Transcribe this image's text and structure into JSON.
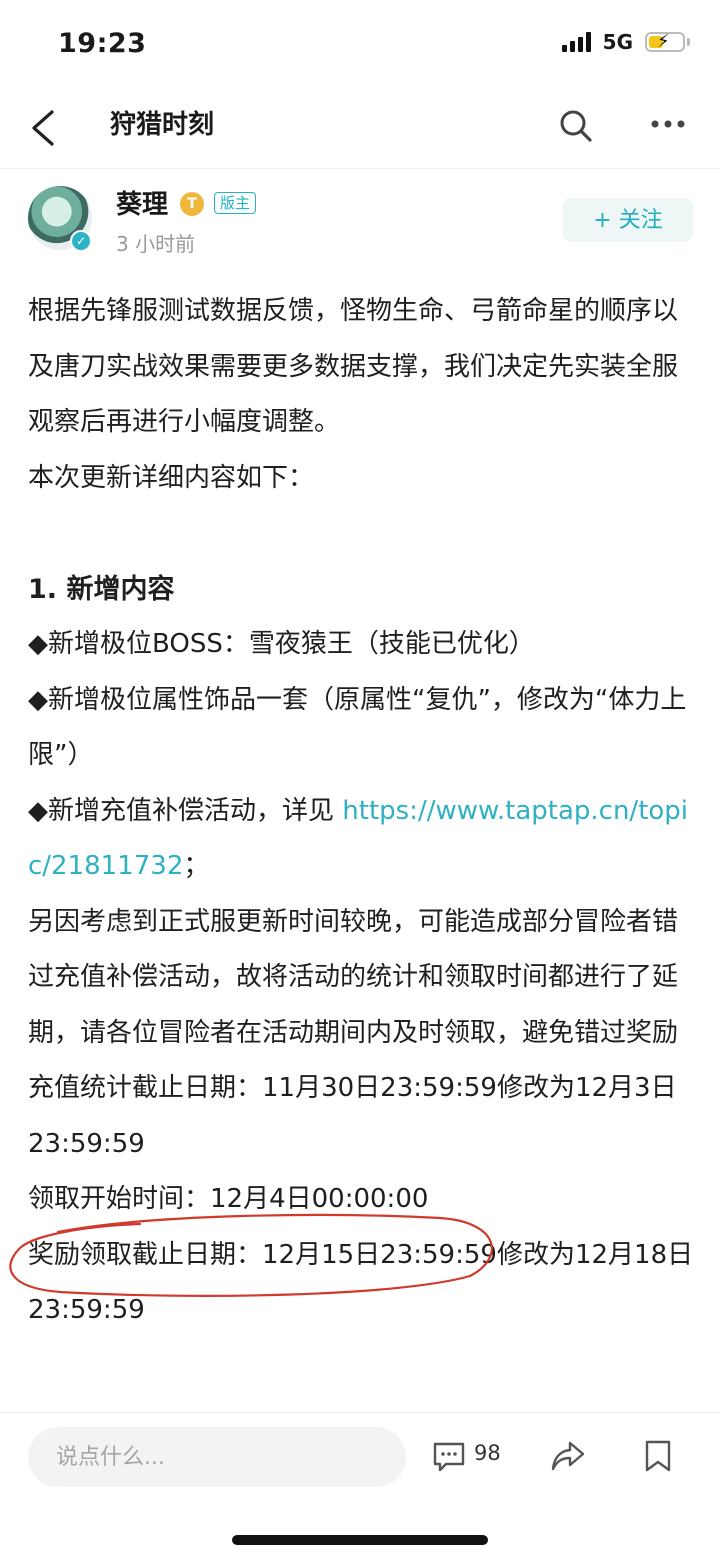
{
  "status_bar": {
    "time": "19:23",
    "network": "5G",
    "icons": [
      "signal-icon",
      "battery-charging-icon"
    ]
  },
  "nav": {
    "title": "狩猎时刻",
    "icons": [
      "back-icon",
      "search-icon",
      "more-icon"
    ]
  },
  "author": {
    "name": "葵理",
    "level_badge": "T",
    "role_badge": "版主",
    "time": "3 小时前",
    "follow_label": "+ 关注",
    "accent_color": "#22b3c5"
  },
  "content": {
    "intro_1": "根据先锋服测试数据反馈，怪物生命、弓箭命星的顺序以及唐刀实战效果需要更多数据支撑，我们决定先实装全服观察后再进行小幅度调整。",
    "intro_2": "本次更新详细内容如下：",
    "section_1": "1. 新增内容",
    "item_1": "◆新增极位BOSS：雪夜猿王（技能已优化）",
    "item_2": "◆新增极位属性饰品一套（原属性“复仇”，修改为“体力上限”）",
    "item_3_prefix": "◆新增充值补偿活动，详见 ",
    "item_3_link": "https://www.taptap.cn/topic/21811732",
    "item_3_suffix": "；",
    "note": "另因考虑到正式服更新时间较晚，可能造成部分冒险者错过充值补偿活动，故将活动的统计和领取时间都进行了延期，请各位冒险者在活动期间内及时领取，避免错过奖励",
    "date_1": "充值统计截止日期：11月30日23:59:59修改为12月3日23:59:59",
    "date_2": "领取开始时间：12月4日00:00:00",
    "date_3": "奖励领取截止日期：12月15日23:59:59修改为12月18日23:59:59",
    "link_color": "#2fb1c3",
    "annotation_color": "#d0392b"
  },
  "bottom_bar": {
    "comment_placeholder": "说点什么...",
    "comment_count": "98",
    "icons": [
      "comment-icon",
      "share-icon",
      "bookmark-icon"
    ]
  }
}
